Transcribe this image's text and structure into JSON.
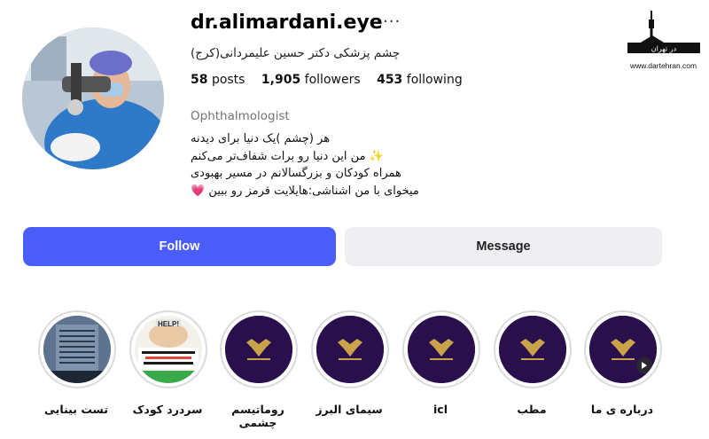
{
  "profile": {
    "username": "dr.alimardani.eye",
    "subtitle": "چشم پزشکی دکتر حسین علیمردانی(کرج)",
    "stats": {
      "posts_value": "58",
      "posts_label": "posts",
      "followers_value": "1,905",
      "followers_label": "followers",
      "following_value": "453",
      "following_label": "following"
    },
    "category": "Ophthalmologist",
    "bio_lines": [
      "هر (چشم )یک دنیا برای دیدنه",
      "✨ من این دنیا رو برات شفاف‌تر می‌کنم",
      "همراه کودکان و بزرگسالانم در مسیر بهبودی",
      "میخوای با من اشناشی:هایلایت قرمز رو ببین 💗"
    ]
  },
  "buttons": {
    "follow": "Follow",
    "message": "Message"
  },
  "watermark": {
    "url": "www.dartehran.com",
    "logo_text": "در تهران"
  },
  "highlights": [
    {
      "label": "تست بینایی",
      "icon": "eye-chart-thumbnail"
    },
    {
      "label": "سردرد کودک",
      "icon": "child-headache-thumbnail",
      "help_text": "HELP!"
    },
    {
      "label": "روماتیسم چشمی",
      "icon": "pasargad-logo"
    },
    {
      "label": "سیمای البرز",
      "icon": "pasargad-logo"
    },
    {
      "label": "icl",
      "icon": "pasargad-logo"
    },
    {
      "label": "مطب",
      "icon": "pasargad-logo"
    },
    {
      "label": "درباره ی ما",
      "icon": "pasargad-logo"
    }
  ],
  "colors": {
    "follow_bg": "#4a5df9",
    "message_bg": "#efeff3",
    "highlight_bg": "#2a0f4d",
    "gold": "#c9a24a"
  }
}
